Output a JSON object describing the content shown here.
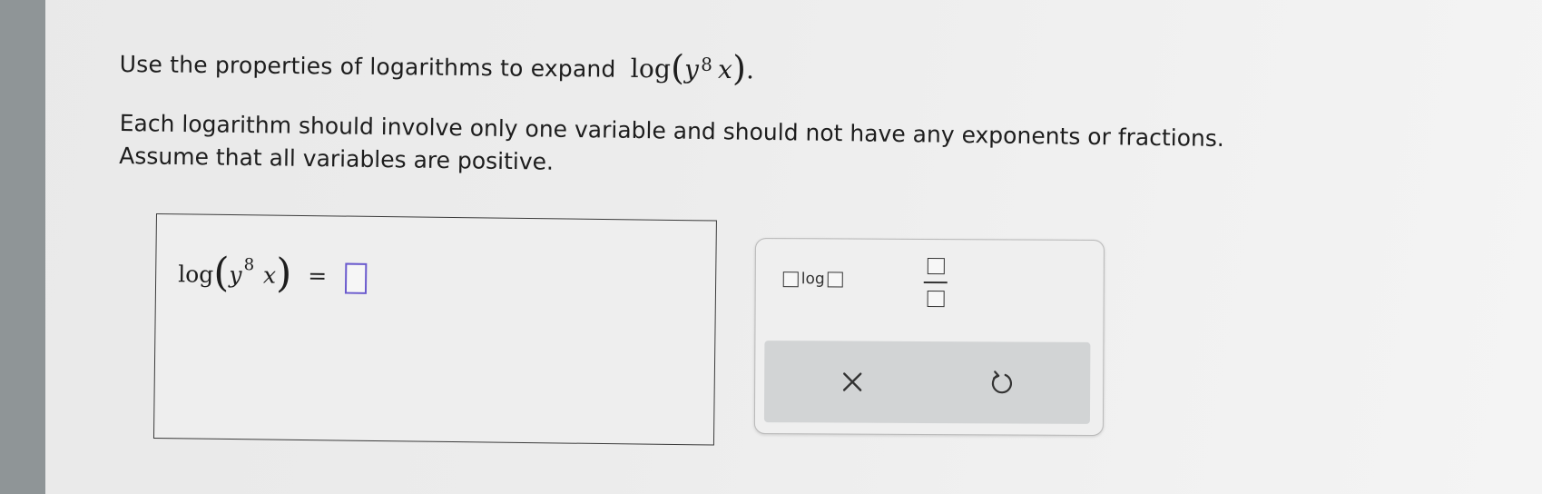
{
  "question": {
    "intro": "Use the properties of logarithms to expand",
    "expr": {
      "func": "log",
      "base": "y",
      "exponent": "8",
      "var": "x"
    },
    "period": ".",
    "line2": "Each logarithm should involve only one variable and should not have any exponents or fractions.",
    "line3": "Assume that all variables are positive."
  },
  "answer": {
    "func": "log",
    "base": "y",
    "exponent": "8",
    "var": "x",
    "equals": "=",
    "value": ""
  },
  "toolbar": {
    "log_label": "log"
  },
  "icons": {
    "clear": "x-icon",
    "reset": "undo-icon"
  },
  "colors": {
    "input_border": "#6a5acd",
    "action_bar": "#d2d4d5"
  }
}
